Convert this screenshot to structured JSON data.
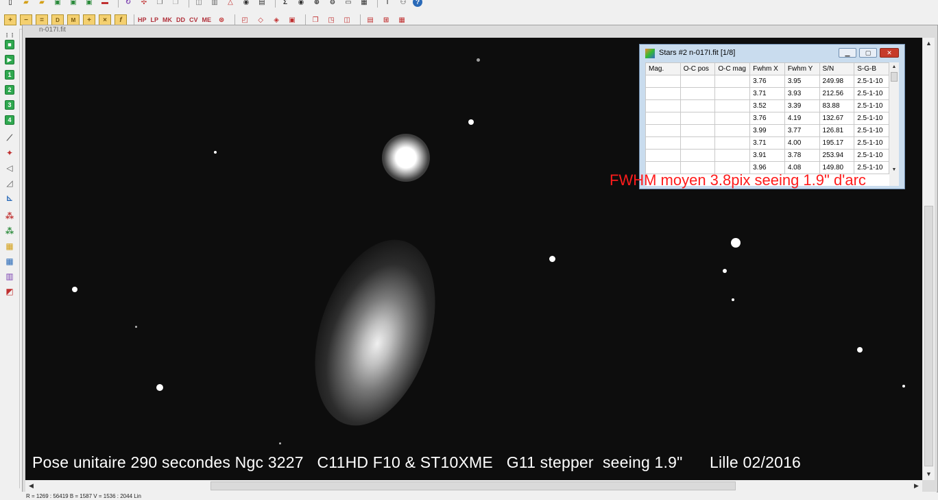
{
  "toolbar": {
    "text_buttons": [
      "HP",
      "LP",
      "MK",
      "DD",
      "CV",
      "ME"
    ]
  },
  "left_toolbar": {
    "numbered_buttons": [
      "1",
      "2",
      "3",
      "4"
    ]
  },
  "image_window": {
    "title": "n-017I.fit",
    "caption": "Pose unitaire 290 secondes Ngc 3227   C11HD F10 & ST10XME   G11 stepper  seeing 1.9\"      Lille 02/2016"
  },
  "stars_window": {
    "title": "Stars #2 n-017I.fit  [1/8]",
    "columns": [
      "Mag.",
      "O-C pos",
      "O-C mag",
      "Fwhm X",
      "Fwhm Y",
      "S/N",
      "S-G-B"
    ],
    "rows": [
      [
        "",
        "",
        "",
        "3.76",
        "3.95",
        "249.98",
        "2.5-1-10"
      ],
      [
        "",
        "",
        "",
        "3.71",
        "3.93",
        "212.56",
        "2.5-1-10"
      ],
      [
        "",
        "",
        "",
        "3.52",
        "3.39",
        "83.88",
        "2.5-1-10"
      ],
      [
        "",
        "",
        "",
        "3.76",
        "4.19",
        "132.67",
        "2.5-1-10"
      ],
      [
        "",
        "",
        "",
        "3.99",
        "3.77",
        "126.81",
        "2.5-1-10"
      ],
      [
        "",
        "",
        "",
        "3.71",
        "4.00",
        "195.17",
        "2.5-1-10"
      ],
      [
        "",
        "",
        "",
        "3.91",
        "3.78",
        "253.94",
        "2.5-1-10"
      ],
      [
        "",
        "",
        "",
        "3.96",
        "4.08",
        "149.80",
        "2.5-1-10"
      ]
    ]
  },
  "overlay_text": "FWHM moyen 3.8pix  seeing 1.9\" d'arc",
  "status": {
    "text": "R = 1269 : 56419   B = 1587   V = 1536 : 2044 Lin"
  },
  "colors": {
    "overlay_red": "#ff1c1c",
    "window_frame": "#c9dcee"
  }
}
